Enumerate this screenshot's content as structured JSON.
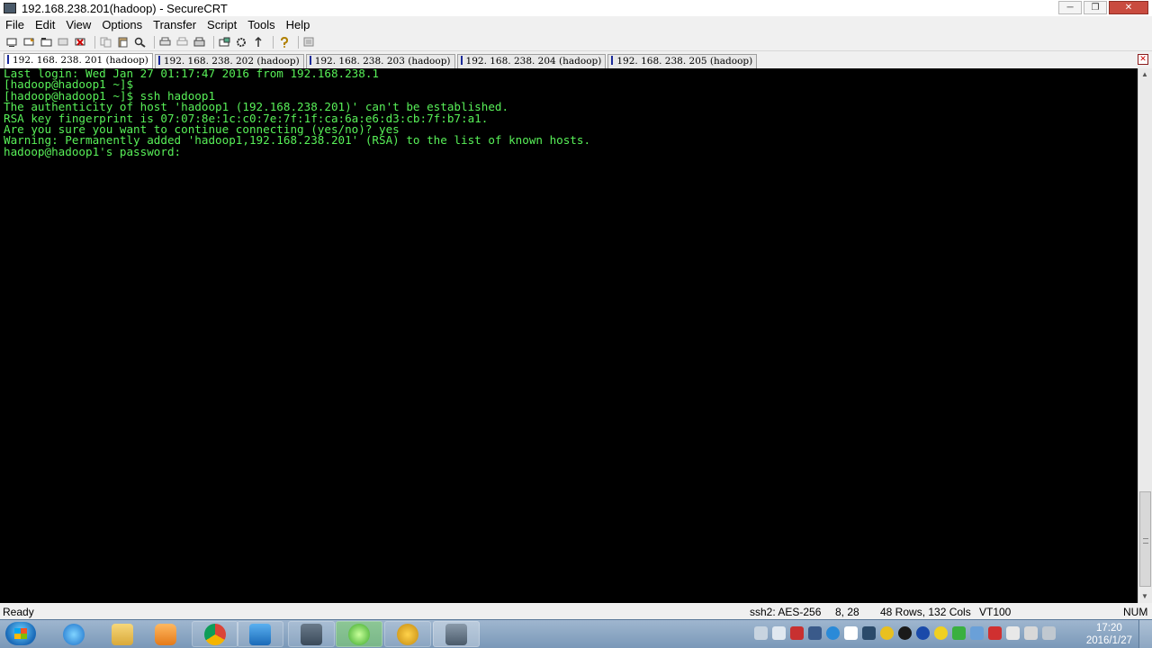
{
  "window": {
    "title": "192.168.238.201(hadoop) - SecureCRT",
    "minimize_glyph": "─",
    "maximize_glyph": "❐",
    "close_glyph": "✕"
  },
  "menu": {
    "items": [
      "File",
      "Edit",
      "View",
      "Options",
      "Transfer",
      "Script",
      "Tools",
      "Help"
    ]
  },
  "toolbar": {
    "icons": [
      "connect-icon",
      "quick-connect-icon",
      "connect-tab-icon",
      "reconnect-icon",
      "disconnect-icon",
      "copy-icon",
      "paste-icon",
      "find-icon",
      "print-setup-icon",
      "print-selection-icon",
      "print-icon",
      "session-options-icon",
      "global-options-icon",
      "keymap-icon",
      "help-icon",
      "sftp-icon"
    ]
  },
  "tabs": {
    "items": [
      {
        "label": "192. 168. 238. 201 (hadoop)",
        "active": true
      },
      {
        "label": "192. 168. 238. 202 (hadoop)",
        "active": false
      },
      {
        "label": "192. 168. 238. 203 (hadoop)",
        "active": false
      },
      {
        "label": "192. 168. 238. 204 (hadoop)",
        "active": false
      },
      {
        "label": "192. 168. 238. 205 (hadoop)",
        "active": false
      }
    ],
    "close_glyph": "✕"
  },
  "terminal": {
    "text_color": "#58f058",
    "background": "#000000",
    "lines": [
      "Last login: Wed Jan 27 01:17:47 2016 from 192.168.238.1",
      "[hadoop@hadoop1 ~]$",
      "[hadoop@hadoop1 ~]$ ssh hadoop1",
      "The authenticity of host 'hadoop1 (192.168.238.201)' can't be established.",
      "RSA key fingerprint is 07:07:8e:1c:c0:7e:7f:1f:ca:6a:e6:d3:cb:7f:b7:a1.",
      "Are you sure you want to continue connecting (yes/no)? yes",
      "Warning: Permanently added 'hadoop1,192.168.238.201' (RSA) to the list of known hosts.",
      "hadoop@hadoop1's password:"
    ]
  },
  "status": {
    "ready": "Ready",
    "cipher": "ssh2: AES-256",
    "cursor": "8,  28",
    "size": "48 Rows, 132 Cols",
    "emulation": "VT100",
    "numlock": "NUM"
  },
  "taskbar": {
    "apps": [
      "internet-explorer-icon",
      "file-explorer-icon",
      "media-player-icon",
      "chrome-icon",
      "outlook-icon",
      "security-app-icon",
      "sync-app-icon",
      "e-app-icon",
      "securecrt-icon"
    ],
    "clock_time": "17:20",
    "clock_date": "2016/1/27"
  }
}
